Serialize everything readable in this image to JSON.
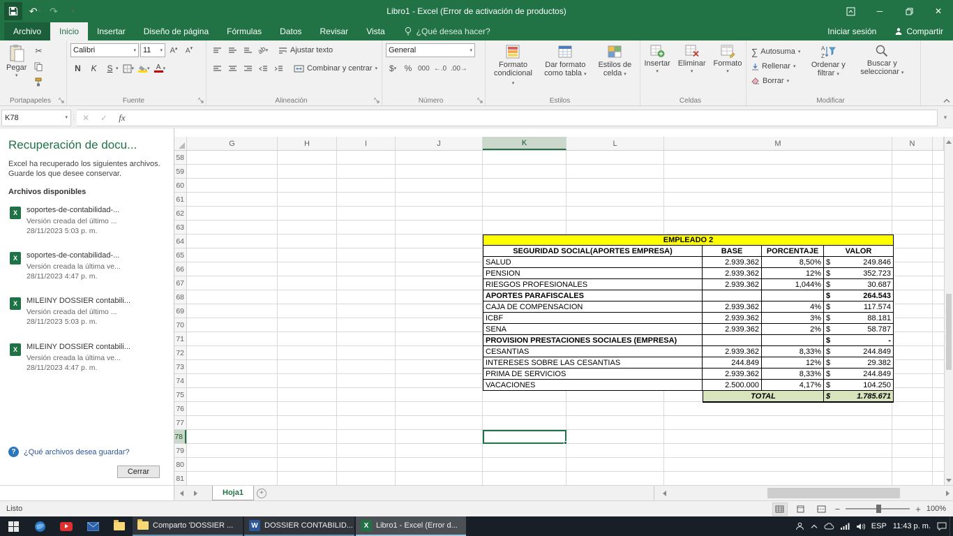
{
  "titlebar": {
    "title": "Libro1 - Excel (Error de activación de productos)"
  },
  "ribbon": {
    "tabs": [
      {
        "label": "Archivo",
        "file": true
      },
      {
        "label": "Inicio",
        "active": true
      },
      {
        "label": "Insertar"
      },
      {
        "label": "Diseño de página"
      },
      {
        "label": "Fórmulas"
      },
      {
        "label": "Datos"
      },
      {
        "label": "Revisar"
      },
      {
        "label": "Vista"
      }
    ],
    "tellme": "¿Qué desea hacer?",
    "signin": "Iniciar sesión",
    "share": "Compartir",
    "groups": {
      "clipboard": {
        "label": "Portapapeles",
        "paste": "Pegar"
      },
      "font": {
        "label": "Fuente",
        "font_name": "Calibri",
        "font_size": "11",
        "bold": "N",
        "italic": "K",
        "underline": "S"
      },
      "alignment": {
        "label": "Alineación",
        "wrap": "Ajustar texto",
        "merge": "Combinar y centrar"
      },
      "number": {
        "label": "Número",
        "format": "General",
        "currency": "$",
        "percent": "%",
        "thousands": "000"
      },
      "styles": {
        "label": "Estilos",
        "conditional": "Formato condicional",
        "as_table": "Dar formato como tabla",
        "cell_styles": "Estilos de celda"
      },
      "cells": {
        "label": "Celdas",
        "insert": "Insertar",
        "delete": "Eliminar",
        "format": "Formato"
      },
      "editing": {
        "label": "Modificar",
        "autosum": "Autosuma",
        "fill": "Rellenar",
        "clear": "Borrar",
        "sort": "Ordenar y filtrar",
        "find": "Buscar y seleccionar"
      }
    }
  },
  "formula_bar": {
    "name_box": "K78",
    "fx": "fx",
    "formula": ""
  },
  "recovery": {
    "title": "Recuperación de docu...",
    "intro": "Excel ha recuperado los siguientes archivos. Guarde los que desee conservar.",
    "available_label": "Archivos disponibles",
    "files": [
      {
        "name": "soportes-de-contabilidad-...",
        "desc": "Versión creada del último ...",
        "date": "28/11/2023 5:03 p. m."
      },
      {
        "name": "soportes-de-contabilidad-...",
        "desc": "Versión creada la última ve...",
        "date": "28/11/2023 4:47 p. m."
      },
      {
        "name": "MILEINY DOSSIER contabili...",
        "desc": "Versión creada del último ...",
        "date": "28/11/2023 5:03 p. m."
      },
      {
        "name": "MILEINY DOSSIER contabili...",
        "desc": "Versión creada la última ve...",
        "date": "28/11/2023 4:47 p. m."
      }
    ],
    "question": "¿Qué archivos desea guardar?",
    "close_label": "Cerrar"
  },
  "sheet": {
    "columns": [
      "G",
      "H",
      "I",
      "J",
      "K",
      "L",
      "M",
      "N"
    ],
    "selected_column": "K",
    "first_row": 58,
    "last_row": 81,
    "selected_row": 78,
    "active_cell": "K78",
    "tab_name": "Hoja1"
  },
  "table": {
    "currency_symbol": "$",
    "colors": {
      "title_bg": "#ffff00",
      "total_bg": "#d8e4bc"
    },
    "rows": [
      {
        "type": "title",
        "label": "EMPLEADO 2"
      },
      {
        "type": "header",
        "label": "SEGURIDAD SOCIAL(APORTES EMPRESA)",
        "base": "BASE",
        "pct": "PORCENTAJE",
        "valor": "VALOR"
      },
      {
        "type": "data",
        "label": "SALUD",
        "base": "2.939.362",
        "pct": "8,50%",
        "valor": "249.846"
      },
      {
        "type": "data",
        "label": "PENSION",
        "base": "2.939.362",
        "pct": "12%",
        "valor": "352.723"
      },
      {
        "type": "data",
        "label": "RIESGOS PROFESIONALES",
        "base": "2.939.362",
        "pct": "1,044%",
        "valor": "30.687"
      },
      {
        "type": "section",
        "label": "APORTES PARAFISCALES",
        "base": "",
        "pct": "",
        "valor": "264.543"
      },
      {
        "type": "data",
        "label": "CAJA DE COMPENSACION",
        "base": "2.939.362",
        "pct": "4%",
        "valor": "117.574"
      },
      {
        "type": "data",
        "label": "ICBF",
        "base": "2.939.362",
        "pct": "3%",
        "valor": "88.181"
      },
      {
        "type": "data",
        "label": "SENA",
        "base": "2.939.362",
        "pct": "2%",
        "valor": "58.787"
      },
      {
        "type": "section",
        "label": "PROVISION PRESTACIONES SOCIALES (EMPRESA)",
        "base": "",
        "pct": "",
        "valor": "-"
      },
      {
        "type": "data",
        "label": "CESANTIAS",
        "base": "2.939.362",
        "pct": "8,33%",
        "valor": "244.849"
      },
      {
        "type": "data",
        "label": "INTERESES SOBRE LAS CESANTIAS",
        "base": "244.849",
        "pct": "12%",
        "valor": "29.382"
      },
      {
        "type": "data",
        "label": "PRIMA DE SERVICIOS",
        "base": "2.939.362",
        "pct": "8,33%",
        "valor": "244.849"
      },
      {
        "type": "data",
        "label": "VACACIONES",
        "base": "2.500.000",
        "pct": "4,17%",
        "valor": "104.250"
      },
      {
        "type": "total",
        "label": "TOTAL",
        "valor": "1.785.671"
      }
    ]
  },
  "status_bar": {
    "mode": "Listo",
    "zoom": "100%"
  },
  "taskbar": {
    "apps": [
      {
        "label": "Comparto 'DOSSIER ...",
        "icon": "folder",
        "active": false
      },
      {
        "label": "DOSSIER CONTABILID...",
        "icon": "word",
        "letter": "W",
        "color": "#2b579a",
        "active": false
      },
      {
        "label": "Libro1 - Excel (Error d...",
        "icon": "excel",
        "letter": "X",
        "color": "#217346",
        "active": true
      }
    ],
    "tray": {
      "lang": "ESP",
      "time": "11:43 p. m."
    }
  },
  "icons": {
    "excel_file_letter": "X"
  }
}
